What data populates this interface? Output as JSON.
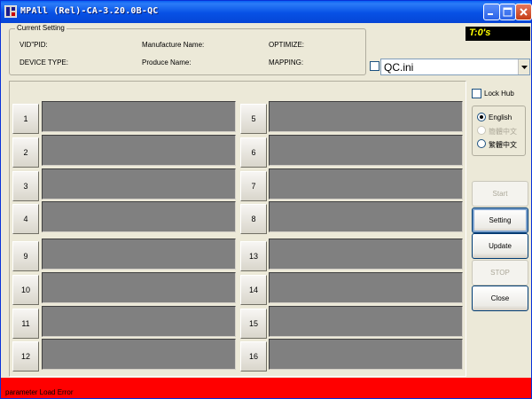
{
  "window": {
    "title": "MPAll (Rel)-CA-3.20.0B-QC"
  },
  "current_setting": {
    "group_title": "Current Setting",
    "vid_pid_label": "VID\"PID:",
    "manufacture_name_label": "Manufacture Name:",
    "optimize_label": "OPTIMIZE:",
    "device_type_label": "DEVICE TYPE:",
    "produce_name_label": "Produce Name:",
    "mapping_label": "MAPPING:"
  },
  "timer": "T:0's",
  "config": {
    "file_selected": "QC.ini",
    "checkbox_checked": false
  },
  "ports": {
    "left": [
      "1",
      "2",
      "3",
      "4",
      "9",
      "10",
      "11",
      "12"
    ],
    "right": [
      "5",
      "6",
      "7",
      "8",
      "13",
      "14",
      "15",
      "16"
    ]
  },
  "options": {
    "lock_hub_label": "Lock Hub",
    "lock_hub_checked": false
  },
  "language": {
    "options": [
      {
        "label": "English",
        "selected": true,
        "enabled": true
      },
      {
        "label": "簡體中文",
        "selected": false,
        "enabled": false
      },
      {
        "label": "繁體中文",
        "selected": false,
        "enabled": true
      }
    ]
  },
  "buttons": {
    "start": "Start",
    "setting": "Setting",
    "update": "Update",
    "stop": "STOP",
    "close": "Close"
  },
  "status": {
    "message": "parameter Load Error",
    "color": "#ff0000"
  }
}
